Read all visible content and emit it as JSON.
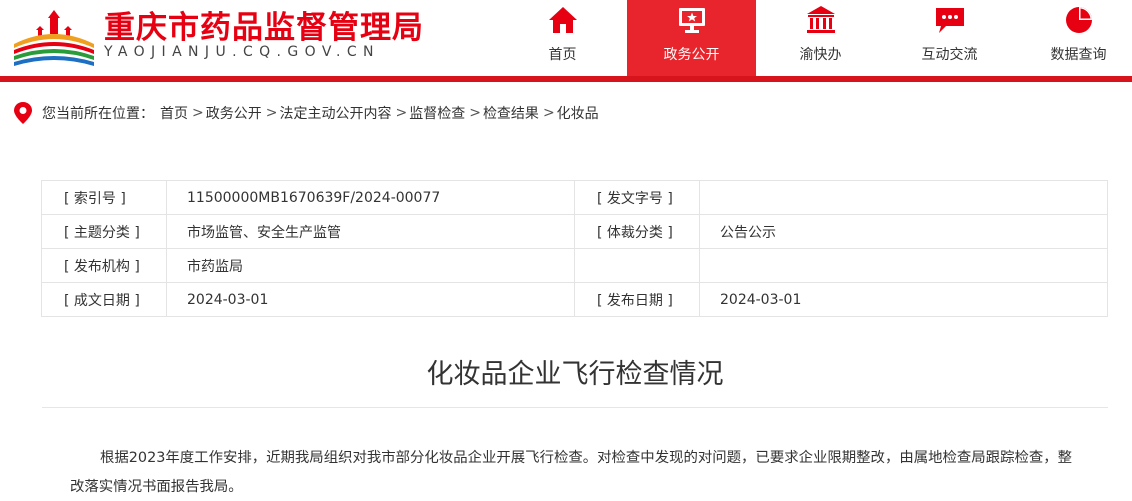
{
  "colors": {
    "brand": "#e60012",
    "nav_active_bg": "#e8252d",
    "header_bar": "#d7141c"
  },
  "header": {
    "title": "重庆市药品监督管理局",
    "domain": "YAOJIANJU.CQ.GOV.CN",
    "logo_icon": "building-logo-icon"
  },
  "nav": {
    "items": [
      {
        "label": "首页",
        "icon": "home-icon",
        "active": false
      },
      {
        "label": "政务公开",
        "icon": "monitor-icon",
        "active": true
      },
      {
        "label": "渝快办",
        "icon": "government-building-icon",
        "active": false
      },
      {
        "label": "互动交流",
        "icon": "chat-bubble-icon",
        "active": false
      },
      {
        "label": "数据查询",
        "icon": "pie-chart-icon",
        "active": false
      }
    ]
  },
  "breadcrumb": {
    "prefix": "您当前所在位置：",
    "items": [
      "首页",
      "政务公开",
      "法定主动公开内容",
      "监督检查",
      "检查结果",
      "化妆品"
    ],
    "separator": ">"
  },
  "meta": {
    "rows": [
      {
        "k1": "[ 索引号 ]",
        "v1": "11500000MB1670639F/2024-00077",
        "k2": "[ 发文字号 ]",
        "v2": ""
      },
      {
        "k1": "[ 主题分类 ]",
        "v1": "市场监管、安全生产监管",
        "k2": "[ 体裁分类 ]",
        "v2": "公告公示"
      },
      {
        "k1": "[ 发布机构 ]",
        "v1": "市药监局",
        "k2": "",
        "v2": ""
      },
      {
        "k1": "[ 成文日期 ]",
        "v1": "2024-03-01",
        "k2": "[ 发布日期 ]",
        "v2": "2024-03-01"
      }
    ]
  },
  "article": {
    "title": "化妆品企业飞行检查情况",
    "body": "根据2023年度工作安排，近期我局组织对我市部分化妆品企业开展飞行检查。对检查中发现的对问题，已要求企业限期整改，由属地检查局跟踪检查，整改落实情况书面报告我局。"
  }
}
